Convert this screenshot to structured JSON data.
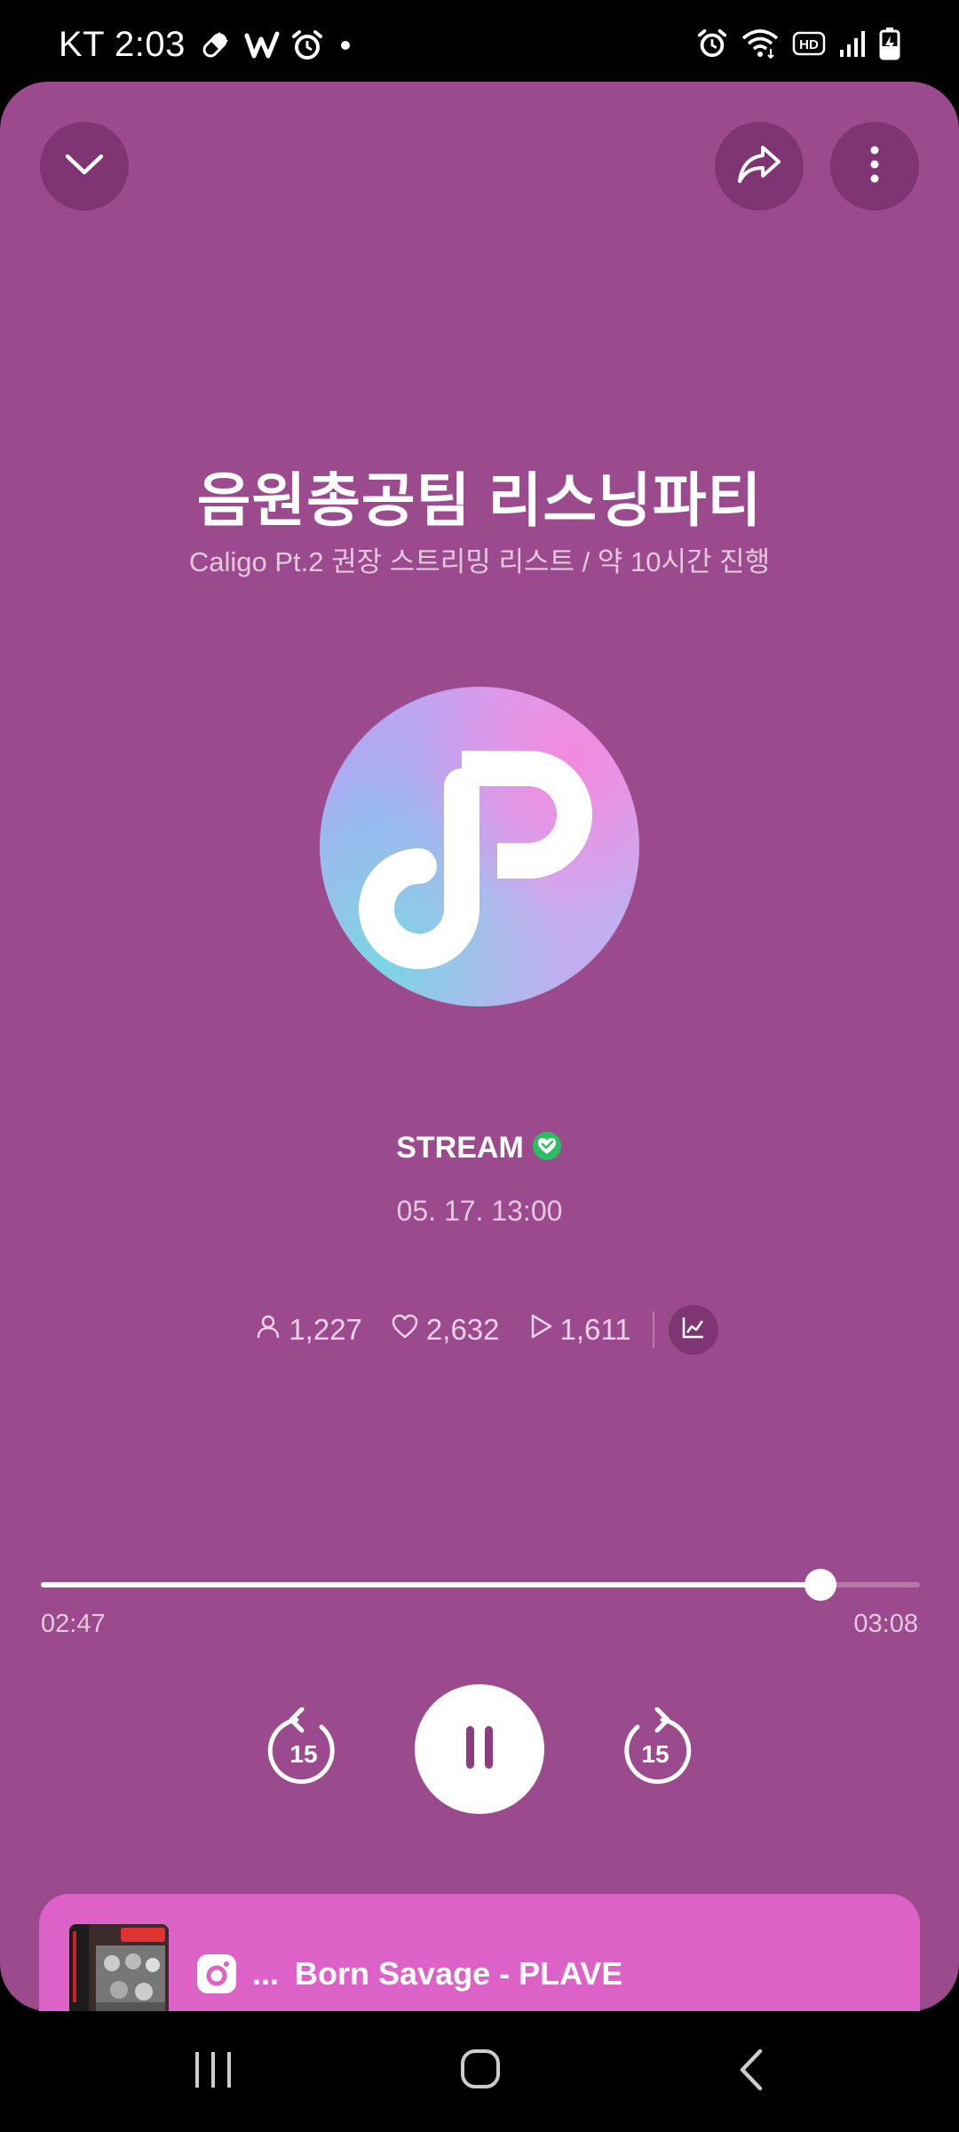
{
  "status_bar": {
    "carrier_time": "KT 2:03",
    "icons_left": [
      "pill-icon",
      "weverse-w-icon",
      "alarm-clock-icon",
      "dot-icon"
    ],
    "icons_right": [
      "alarm-icon",
      "wifi-icon",
      "hd-icon",
      "signal-icon",
      "battery-charging-icon"
    ]
  },
  "header": {
    "collapse_icon": "chevron-down-icon",
    "share_icon": "share-arrow-icon",
    "more_icon": "more-vertical-icon"
  },
  "party": {
    "title": "음원총공팀 리스닝파티",
    "subtitle": "Caligo Pt.2 권장 스트리밍 리스트 / 약 10시간 진행",
    "channel_name": "STREAM",
    "date": "05. 17. 13:00"
  },
  "stats": {
    "listeners": "1,227",
    "likes": "2,632",
    "plays": "1,611"
  },
  "player": {
    "current_time": "02:47",
    "total_time": "03:08",
    "progress_fraction": 0.887,
    "rewind_label": "15",
    "forward_label": "15"
  },
  "now_playing": {
    "dots": "...",
    "track": "Born Savage - PLAVE"
  },
  "colors": {
    "card_bg": "#9B4A8D",
    "button_bg": "#7F3574",
    "now_bar_bg": "#DC62C8",
    "verified_green": "#2DBE64"
  }
}
